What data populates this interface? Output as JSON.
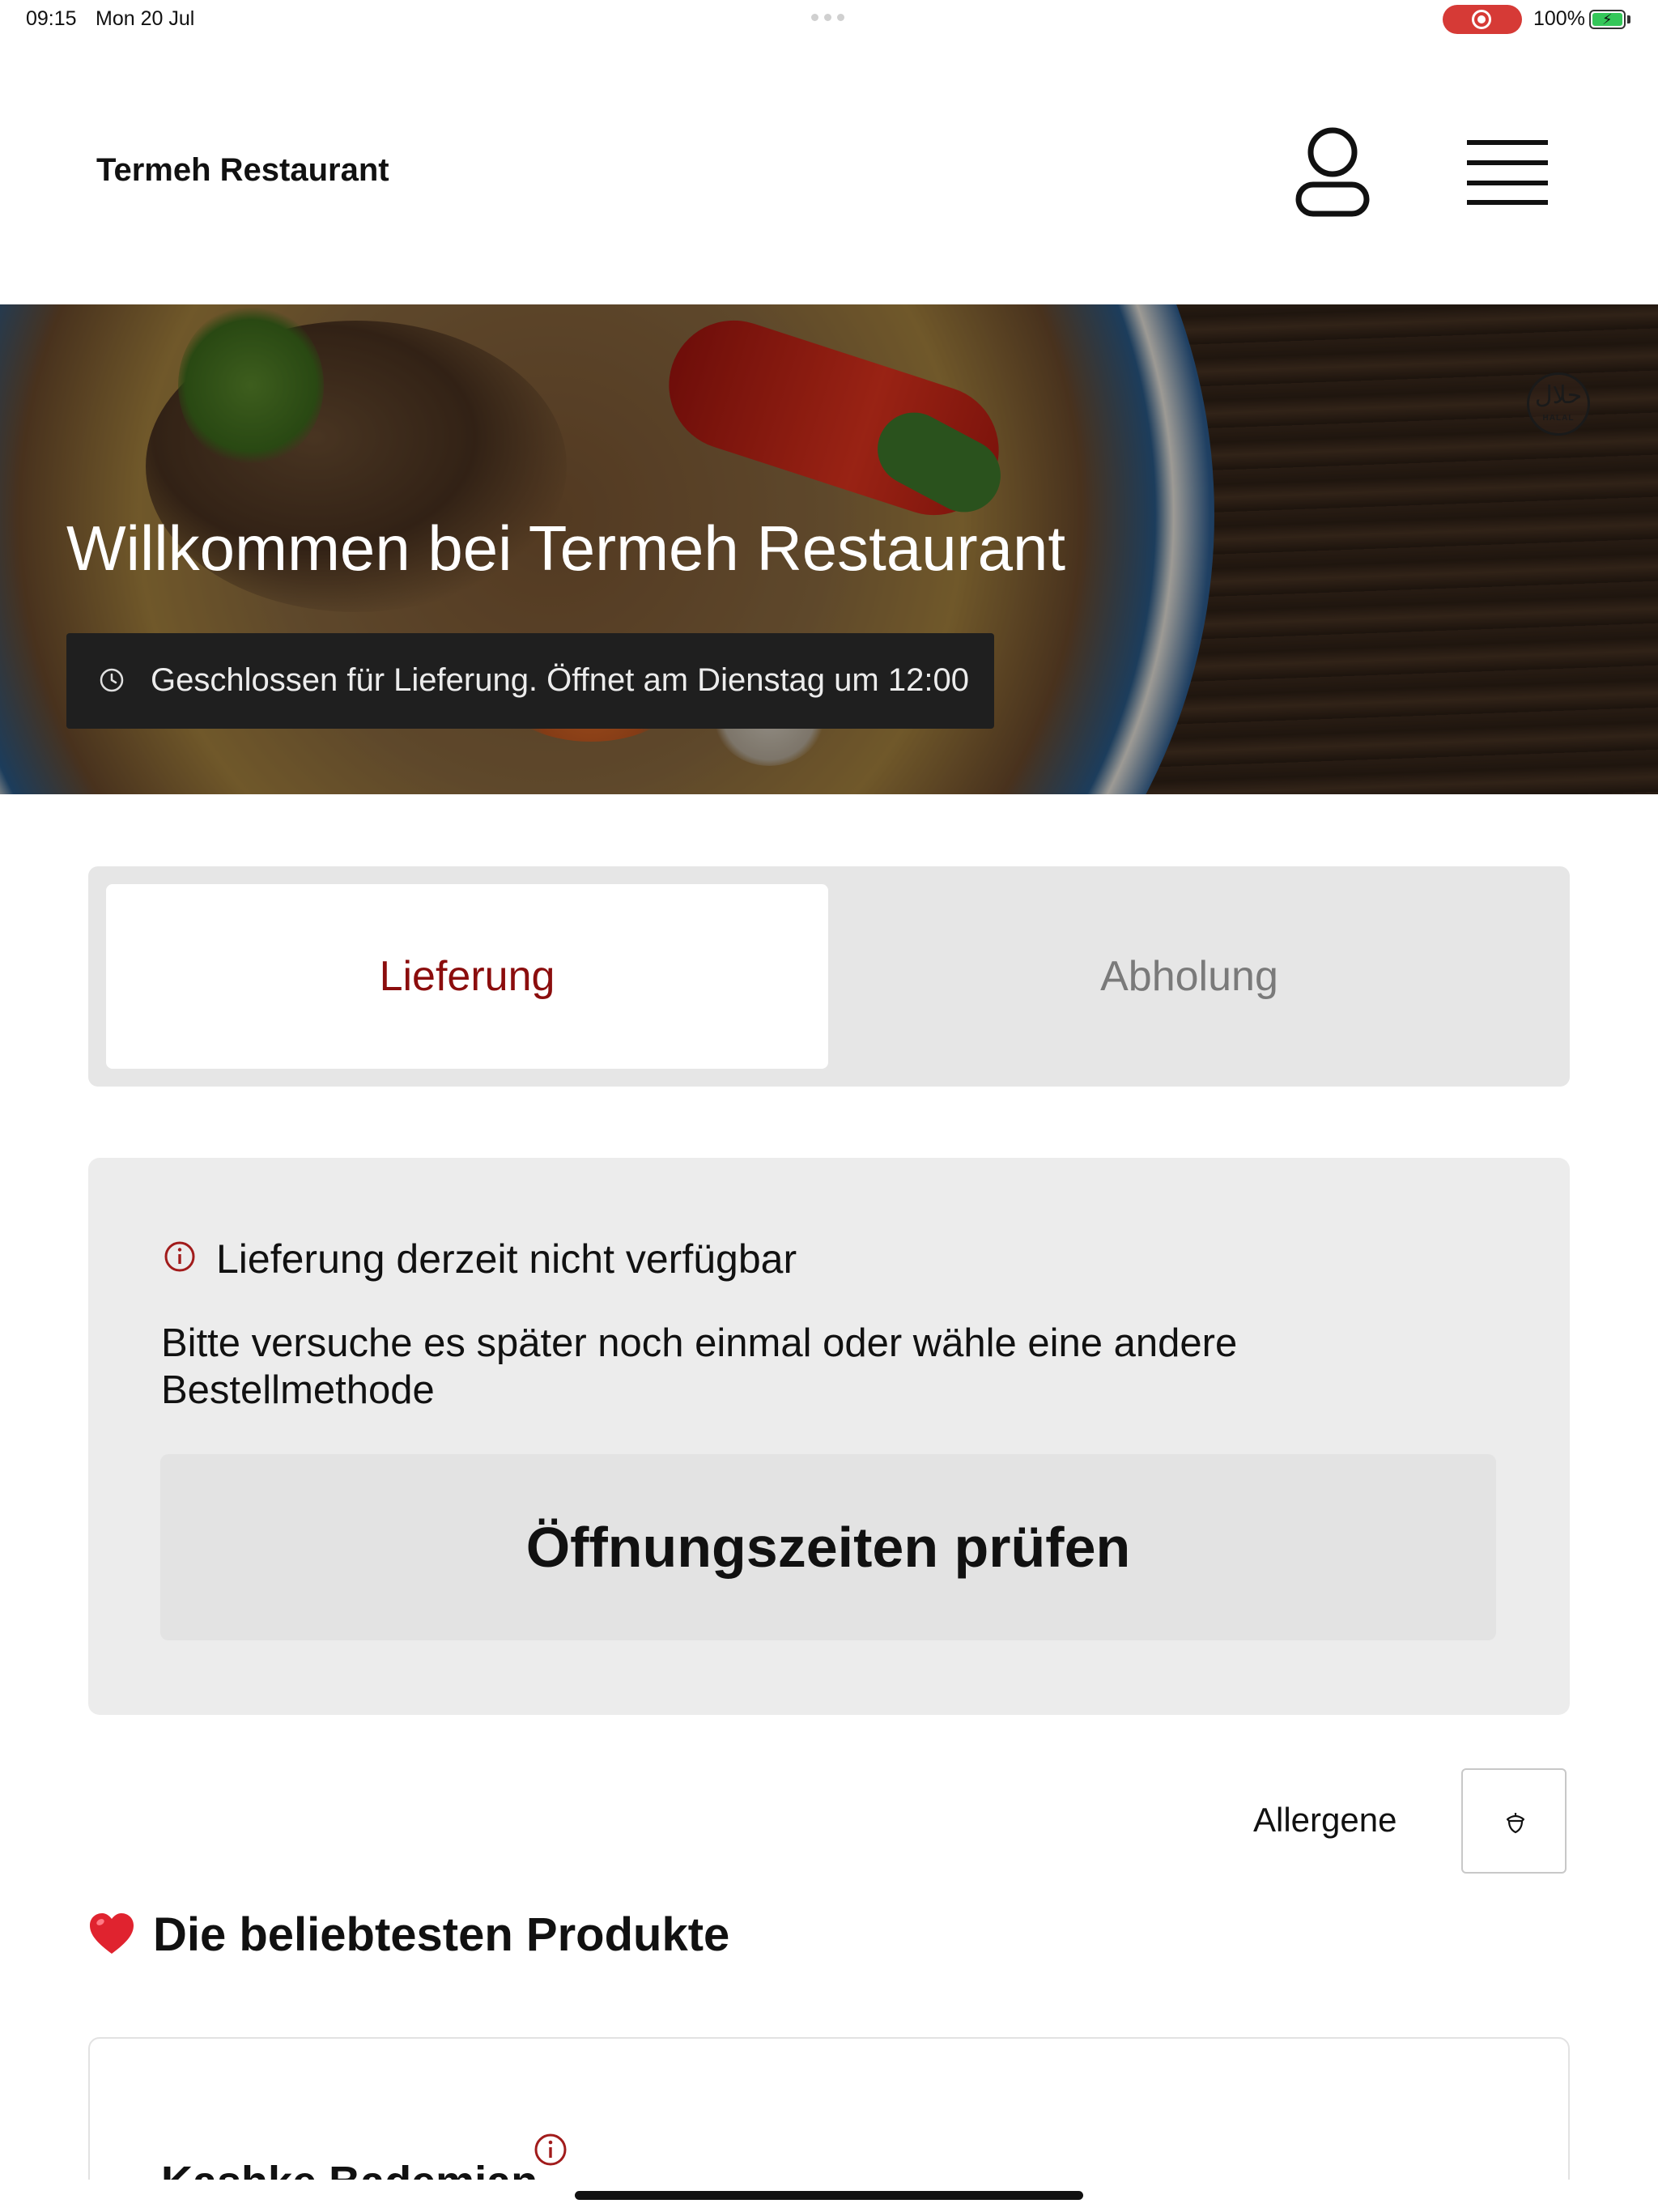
{
  "status_bar": {
    "time": "09:15",
    "date": "Mon 20 Jul",
    "battery_percent": "100%",
    "battery_level": 1.0,
    "recording_color": "#d63a36"
  },
  "header": {
    "brand": "Termeh Restaurant",
    "user_icon": "user-icon",
    "menu_icon": "hamburger-menu-icon"
  },
  "hero": {
    "title": "Willkommen bei Termeh Restaurant",
    "status_text": "Geschlossen für Lieferung. Öffnet am Dienstag um 12:00",
    "badge_arabic": "حلال",
    "badge_label": "HALAL"
  },
  "tabs": {
    "delivery": "Lieferung",
    "pickup": "Abholung",
    "active": "delivery",
    "active_color": "#8b0d0d"
  },
  "notice": {
    "title": "Lieferung derzeit nicht verfügbar",
    "body": "Bitte versuche es später noch einmal oder wähle eine andere Bestellmethode",
    "button": "Öffnungszeiten prüfen",
    "icon": "info-icon"
  },
  "allergen": {
    "label": "Allergene",
    "icon": "acorn-icon"
  },
  "section": {
    "title": "Die beliebtesten Produkte",
    "icon": "heart-icon"
  },
  "products": [
    {
      "name": "Kashke Bademjan"
    }
  ]
}
